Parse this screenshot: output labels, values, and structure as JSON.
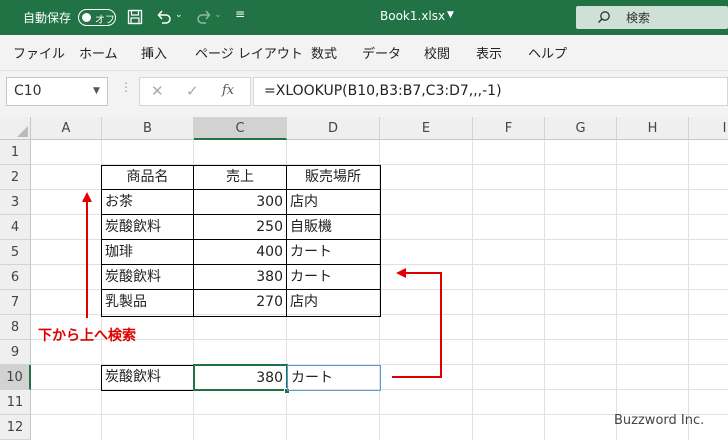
{
  "titlebar": {
    "autosave_label": "自動保存",
    "autosave_state": "オフ",
    "filename": "Book1.xlsx",
    "search_placeholder": "検索",
    "accent": "#217346"
  },
  "ribbon": {
    "tabs": [
      "ファイル",
      "ホーム",
      "挿入",
      "ページ レイアウト",
      "数式",
      "データ",
      "校閲",
      "表示",
      "ヘルプ"
    ]
  },
  "formula_bar": {
    "name_box": "C10",
    "fx": "fx",
    "formula": "=XLOOKUP(B10,B3:B7,C3:D7,,,-1)"
  },
  "sheet": {
    "columns": [
      "A",
      "B",
      "C",
      "D",
      "E",
      "F",
      "G",
      "H",
      "I"
    ],
    "rows": [
      "1",
      "2",
      "3",
      "4",
      "5",
      "6",
      "7",
      "8",
      "9",
      "10",
      "11",
      "12"
    ],
    "headers": [
      "商品名",
      "売上",
      "販売場所"
    ],
    "table": [
      [
        "お茶",
        "300",
        "店内"
      ],
      [
        "炭酸飲料",
        "250",
        "自販機"
      ],
      [
        "珈琲",
        "400",
        "カート"
      ],
      [
        "炭酸飲料",
        "380",
        "カート"
      ],
      [
        "乳製品",
        "270",
        "店内"
      ]
    ],
    "result": [
      "炭酸飲料",
      "380",
      "カート"
    ],
    "selected_cell": "C10"
  },
  "annotation": {
    "note": "下から上へ検索",
    "color": "#e00000"
  },
  "watermark": "Buzzword Inc."
}
